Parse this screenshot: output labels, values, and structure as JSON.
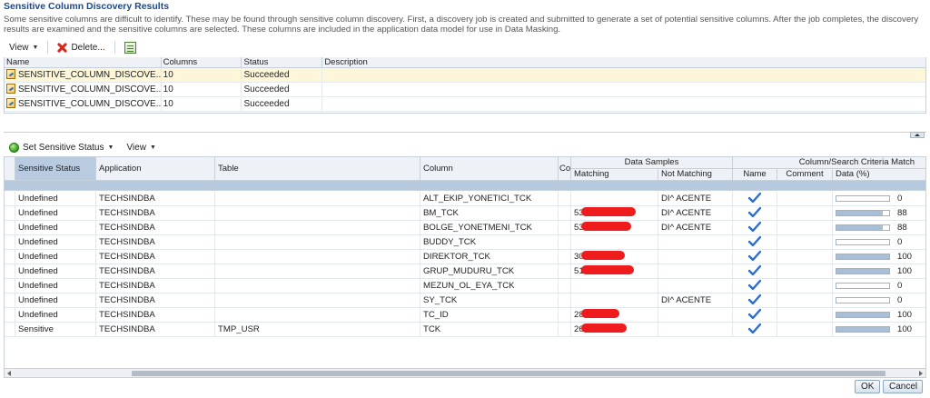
{
  "page": {
    "title": "Sensitive Column Discovery Results",
    "description": "Some sensitive columns are difficult to identify. These may be found through sensitive column discovery. First, a discovery job is created and submitted to generate a set of potential sensitive columns. After the job completes, the discovery results are examined and the sensitive columns are selected. These columns are included in the application data model for use in Data Masking."
  },
  "top_toolbar": {
    "view_label": "View",
    "delete_label": "Delete..."
  },
  "results_table": {
    "headers": [
      "Name",
      "Columns",
      "Status",
      "Description"
    ],
    "rows": [
      {
        "name": "SENSITIVE_COLUMN_DISCOVE...",
        "columns": "10",
        "status": "Succeeded",
        "description": ""
      },
      {
        "name": "SENSITIVE_COLUMN_DISCOVE...",
        "columns": "10",
        "status": "Succeeded",
        "description": ""
      },
      {
        "name": "SENSITIVE_COLUMN_DISCOVE...",
        "columns": "10",
        "status": "Succeeded",
        "description": ""
      }
    ]
  },
  "bottom_toolbar": {
    "set_status_label": "Set Sensitive Status",
    "view_label": "View"
  },
  "columns_table": {
    "headers": {
      "sensitive_status": "Sensitive Status",
      "application": "Application",
      "table": "Table",
      "column": "Column",
      "co": "Co",
      "data_samples": "Data Samples",
      "matching": "Matching",
      "not_matching": "Not Matching",
      "criteria_match": "Column/Search Criteria Match",
      "name": "Name",
      "comment": "Comment",
      "data_pct": "Data (%)"
    },
    "rows": [
      {
        "status": "Undefined",
        "application": "TECHSINDBA",
        "table": "",
        "column": "ALT_EKIP_YONETICI_TCK",
        "matching": "",
        "not_matching": "DI^ ACENTE",
        "data_pct": 0
      },
      {
        "status": "Undefined",
        "application": "TECHSINDBA",
        "table": "",
        "column": "BM_TCK",
        "matching": "53",
        "not_matching": "DI^ ACENTE",
        "data_pct": 88
      },
      {
        "status": "Undefined",
        "application": "TECHSINDBA",
        "table": "",
        "column": "BOLGE_YONETMENI_TCK",
        "matching": "53",
        "not_matching": "DI^ ACENTE",
        "data_pct": 88
      },
      {
        "status": "Undefined",
        "application": "TECHSINDBA",
        "table": "",
        "column": "BUDDY_TCK",
        "matching": "",
        "not_matching": "",
        "data_pct": 0
      },
      {
        "status": "Undefined",
        "application": "TECHSINDBA",
        "table": "",
        "column": "DIREKTOR_TCK",
        "matching": "30",
        "not_matching": "",
        "data_pct": 100
      },
      {
        "status": "Undefined",
        "application": "TECHSINDBA",
        "table": "",
        "column": "GRUP_MUDURU_TCK",
        "matching": "51",
        "not_matching": "",
        "data_pct": 100
      },
      {
        "status": "Undefined",
        "application": "TECHSINDBA",
        "table": "",
        "column": "MEZUN_OL_EYA_TCK",
        "matching": "",
        "not_matching": "",
        "data_pct": 0
      },
      {
        "status": "Undefined",
        "application": "TECHSINDBA",
        "table": "",
        "column": "SY_TCK",
        "matching": "",
        "not_matching": "DI^ ACENTE",
        "data_pct": 0
      },
      {
        "status": "Undefined",
        "application": "TECHSINDBA",
        "table": "",
        "column": "TC_ID",
        "matching": "28",
        "not_matching": "",
        "data_pct": 100
      },
      {
        "status": "Sensitive",
        "application": "TECHSINDBA",
        "table": "TMP_USR",
        "column": "TCK",
        "matching": "26",
        "not_matching": "",
        "data_pct": 100
      }
    ]
  },
  "footer": {
    "ok_label": "OK",
    "cancel_label": "Cancel"
  },
  "colors": {
    "title": "#1b4b8a",
    "header_bg": "#eef2f6",
    "selected_row": "#fdf6d8",
    "redaction": "#ee1c1c"
  }
}
